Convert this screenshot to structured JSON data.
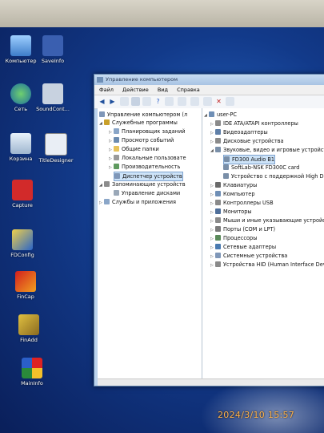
{
  "desktop": {
    "icons": [
      {
        "label": "Компьютер"
      },
      {
        "label": "SaveInfo"
      },
      {
        "label": "Сеть"
      },
      {
        "label": "SoundCont..."
      },
      {
        "label": "Корзина"
      },
      {
        "label": "TitleDesigner"
      },
      {
        "label": "Capture"
      },
      {
        "label": "FDConfig"
      },
      {
        "label": "FinCap"
      },
      {
        "label": "FinAdd"
      },
      {
        "label": "MainInfo"
      }
    ]
  },
  "window": {
    "title": "Управление компьютером",
    "menu": [
      "Файл",
      "Действие",
      "Вид",
      "Справка"
    ]
  },
  "tree_left": {
    "items": [
      {
        "label": "Управление компьютером (л"
      },
      {
        "label": "Служебные программы"
      },
      {
        "label": "Планировщик заданий"
      },
      {
        "label": "Просмотр событий"
      },
      {
        "label": "Общие папки"
      },
      {
        "label": "Локальные пользовате"
      },
      {
        "label": "Производительность"
      },
      {
        "label": "Диспетчер устройств"
      },
      {
        "label": "Запоминающие устройств"
      },
      {
        "label": "Управление дисками"
      },
      {
        "label": "Службы и приложения"
      }
    ]
  },
  "tree_right": {
    "items": [
      {
        "label": "user-PC"
      },
      {
        "label": "IDE ATA/ATAPI контроллеры"
      },
      {
        "label": "Видеоадаптеры"
      },
      {
        "label": "Дисковые устройства"
      },
      {
        "label": "Звуковые, видео и игровые устройства"
      },
      {
        "label": "FD300 Audio B1"
      },
      {
        "label": "SoftLab-NSK FD300C card"
      },
      {
        "label": "Устройство с поддержкой High Definitio"
      },
      {
        "label": "Клавиатуры"
      },
      {
        "label": "Компьютер"
      },
      {
        "label": "Контроллеры USB"
      },
      {
        "label": "Мониторы"
      },
      {
        "label": "Мыши и иные указывающие устройства"
      },
      {
        "label": "Порты (COM и LPT)"
      },
      {
        "label": "Процессоры"
      },
      {
        "label": "Сетевые адаптеры"
      },
      {
        "label": "Системные устройства"
      },
      {
        "label": "Устройства HID (Human Interface Devices)"
      }
    ]
  },
  "timestamp": "2024/3/10 15:57",
  "colors": {
    "selected_bg": "#cde3f8",
    "desktop_blue": "#123a8a",
    "timestamp": "#ffb24a"
  }
}
